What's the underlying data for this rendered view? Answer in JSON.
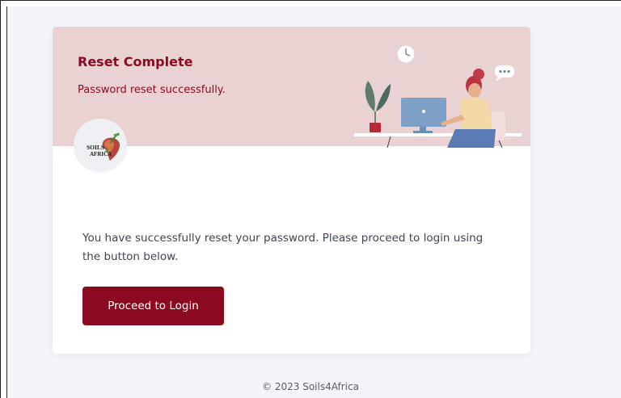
{
  "header": {
    "title": "Reset Complete",
    "subtitle": "Password reset successfully."
  },
  "logo": {
    "text_line1": "SOILS",
    "text_line2": "4",
    "text_line3": "AFRICA"
  },
  "body": {
    "message": "You have successfully reset your password. Please proceed to login using the button below."
  },
  "actions": {
    "login_label": "Proceed to Login"
  },
  "footer": {
    "copyright": "© 2023 Soils4Africa"
  },
  "colors": {
    "brand": "#8b0a1f",
    "header_bg": "#ead2d2",
    "page_bg": "#f4f5f8"
  }
}
